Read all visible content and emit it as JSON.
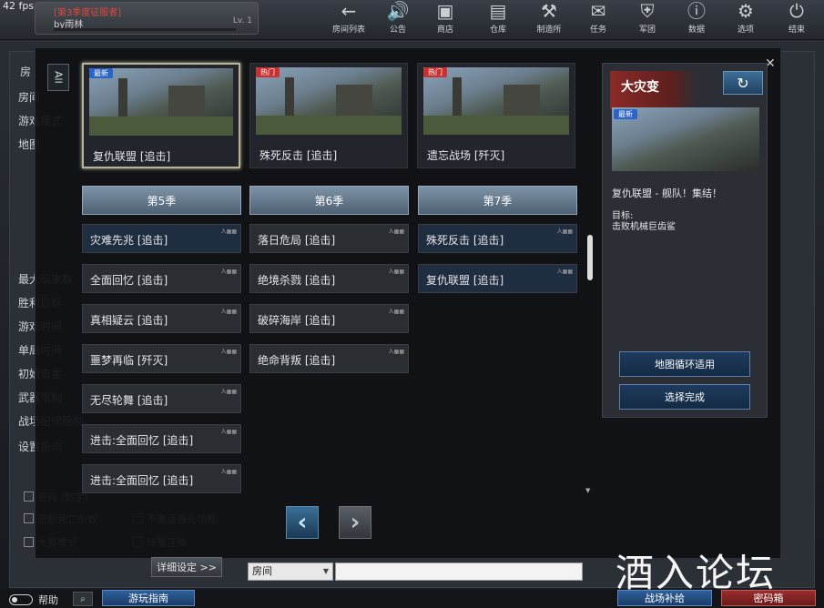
{
  "fps": "42 fps",
  "user": {
    "season_title": "[第3季度征服者]",
    "name": "by雨林",
    "level": "Lv. 1"
  },
  "nav": [
    {
      "label": "房间列表",
      "icon": "←"
    },
    {
      "label": "公告",
      "icon": "🔊"
    },
    {
      "label": "商店",
      "icon": "▣"
    },
    {
      "label": "仓库",
      "icon": "▤"
    },
    {
      "label": "制造所",
      "icon": "⚒"
    },
    {
      "label": "任务",
      "icon": "✉"
    },
    {
      "label": "军团",
      "icon": "⛨"
    },
    {
      "label": "数据",
      "icon": "ⓘ"
    },
    {
      "label": "选项",
      "icon": "⚙"
    },
    {
      "label": "结束",
      "icon": "⏻"
    }
  ],
  "background": {
    "labels": [
      "房",
      "房间",
      "游戏模式",
      "地图",
      "最大玩家数",
      "胜利目标",
      "游戏时间",
      "单局时间",
      "初始资金",
      "武器限制",
      "战场纪律限制",
      "设置投向"
    ],
    "checks": [
      "密码 (数字)",
      "限制死亡杀数",
      "不激活强化功能",
      "大赛模式",
      "阵营互换"
    ]
  },
  "modal": {
    "all_tab": "All",
    "featured": [
      {
        "tag": "最新",
        "tag_type": "new",
        "name": "复仇联盟 [追击]",
        "selected": true
      },
      {
        "tag": "热门",
        "tag_type": "hot",
        "name": "殊死反击 [追击]",
        "selected": false
      },
      {
        "tag": "热门",
        "tag_type": "hot",
        "name": "遗忘战场 [歼灭]",
        "selected": false
      }
    ],
    "seasons": [
      {
        "label": "第5季",
        "items": [
          {
            "name": "灾难先兆 [追击]",
            "badge": "入▦▦",
            "hl": true
          },
          {
            "name": "全面回忆 [追击]",
            "badge": "入▦▦",
            "hl": false
          },
          {
            "name": "真相疑云 [追击]",
            "badge": "入▦▦",
            "hl": false
          },
          {
            "name": "噩梦再临 [歼灭]",
            "badge": "入▦▦",
            "hl": false
          },
          {
            "name": "无尽轮舞 [追击]",
            "badge": "入▦▦",
            "hl": false
          },
          {
            "name": "进击:全面回忆 [追击]",
            "badge": "入▦▦",
            "hl": false
          },
          {
            "name": "进击:全面回忆 [追击]",
            "badge": "入▦▦",
            "hl": false
          }
        ]
      },
      {
        "label": "第6季",
        "items": [
          {
            "name": "落日危局 [追击]",
            "badge": "入▦▦",
            "hl": false
          },
          {
            "name": "绝境杀戮 [追击]",
            "badge": "入▦▦",
            "hl": false
          },
          {
            "name": "破碎海岸 [追击]",
            "badge": "入▦▦",
            "hl": false
          },
          {
            "name": "绝命背叛 [追击]",
            "badge": "入▦▦",
            "hl": false
          }
        ]
      },
      {
        "label": "第7季",
        "items": [
          {
            "name": "殊死反击 [追击]",
            "badge": "入▦▦",
            "hl": true
          },
          {
            "name": "复仇联盟 [追击]",
            "badge": "入▦▦",
            "hl": true
          }
        ]
      }
    ],
    "info": {
      "title": "大灾变",
      "tag": "最新",
      "desc": "复仇联盟 - 舰队！集结！",
      "goal_label": "目标:",
      "goal_value": "击败机械巨齿鲨",
      "btn_cycle": "地图循环适用",
      "btn_done": "选择完成"
    },
    "search": {
      "select": "房间"
    }
  },
  "bottom": {
    "detail": "详细设定 >>",
    "help": "帮助",
    "guide": "游玩指南",
    "supply": "战场补给",
    "code": "密码箱"
  },
  "watermark": "酒入论坛"
}
